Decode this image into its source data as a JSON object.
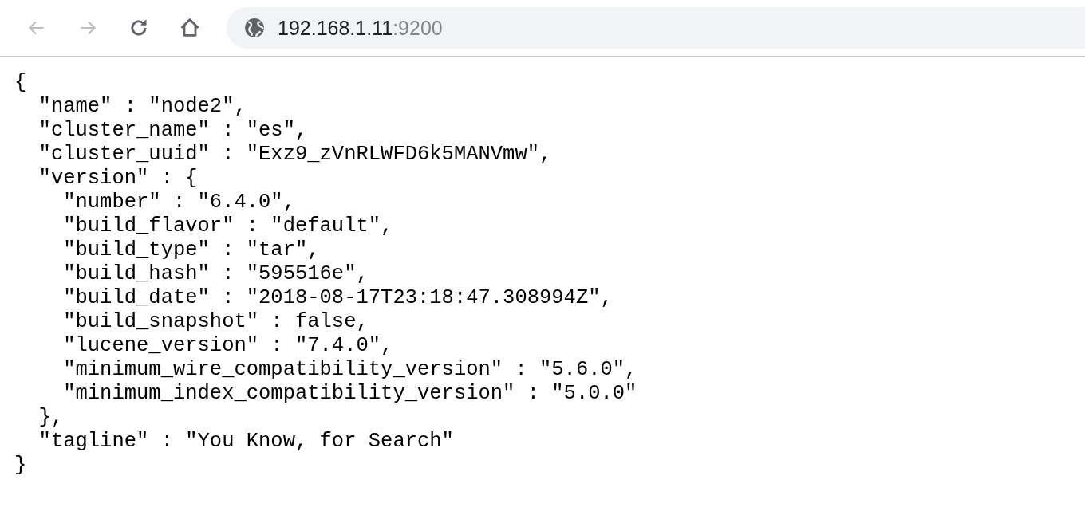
{
  "toolbar": {
    "back": {
      "disabled": true
    },
    "forward": {
      "disabled": true
    },
    "address": {
      "host": "192.168.1.11",
      "port": ":9200"
    }
  },
  "body": {
    "lines": [
      "{",
      "  \"name\" : \"node2\",",
      "  \"cluster_name\" : \"es\",",
      "  \"cluster_uuid\" : \"Exz9_zVnRLWFD6k5MANVmw\",",
      "  \"version\" : {",
      "    \"number\" : \"6.4.0\",",
      "    \"build_flavor\" : \"default\",",
      "    \"build_type\" : \"tar\",",
      "    \"build_hash\" : \"595516e\",",
      "    \"build_date\" : \"2018-08-17T23:18:47.308994Z\",",
      "    \"build_snapshot\" : false,",
      "    \"lucene_version\" : \"7.4.0\",",
      "    \"minimum_wire_compatibility_version\" : \"5.6.0\",",
      "    \"minimum_index_compatibility_version\" : \"5.0.0\"",
      "  },",
      "  \"tagline\" : \"You Know, for Search\"",
      "}"
    ]
  }
}
